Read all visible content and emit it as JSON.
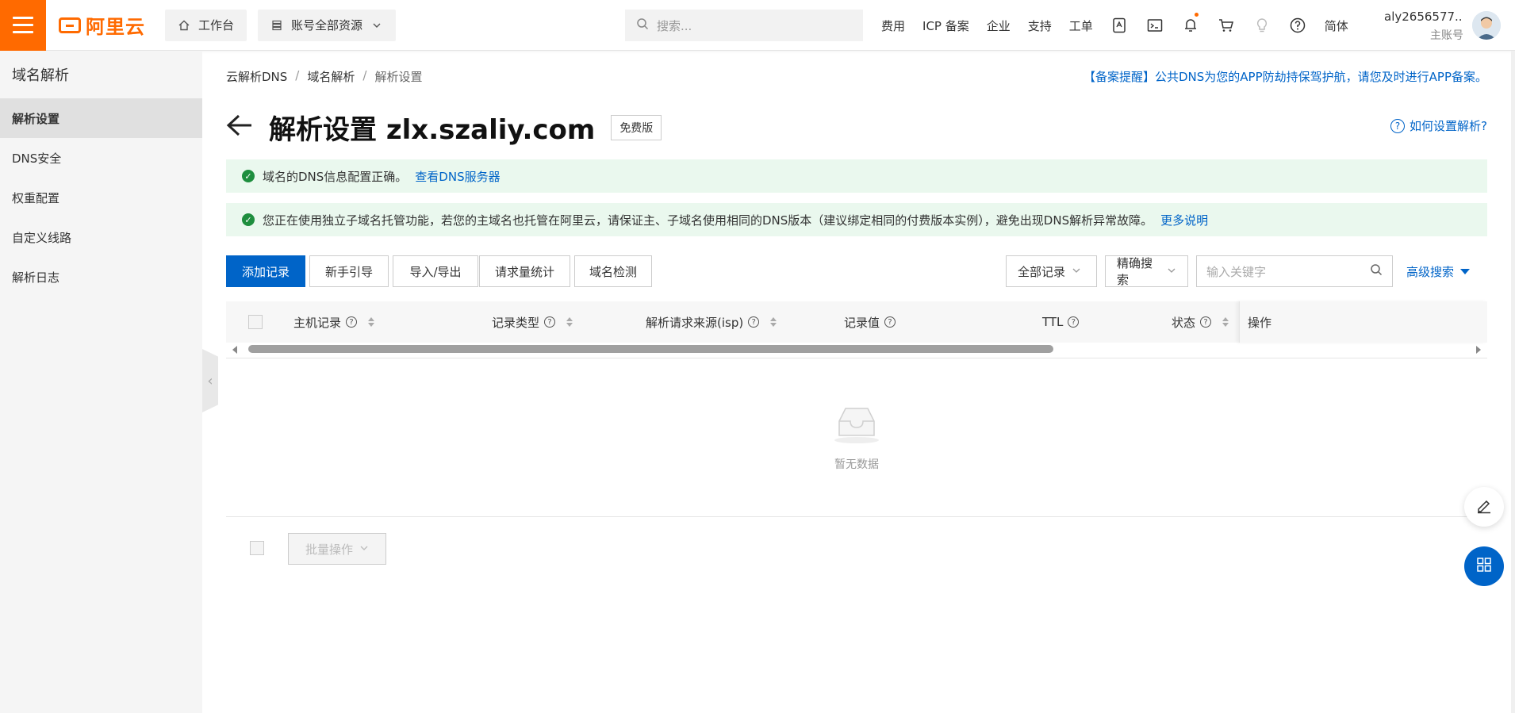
{
  "topbar": {
    "logo_text": "阿里云",
    "workbench_label": "工作台",
    "resources_label": "账号全部资源",
    "search_placeholder": "搜索...",
    "links": [
      "费用",
      "ICP 备案",
      "企业",
      "支持",
      "工单"
    ],
    "lang_label": "简体",
    "user_name": "aly2656577...",
    "user_role": "主账号"
  },
  "sidebar": {
    "title": "域名解析",
    "items": [
      {
        "label": "解析设置",
        "active": true
      },
      {
        "label": "DNS安全",
        "active": false
      },
      {
        "label": "权重配置",
        "active": false
      },
      {
        "label": "自定义线路",
        "active": false
      },
      {
        "label": "解析日志",
        "active": false
      }
    ]
  },
  "breadcrumb": [
    "云解析DNS",
    "域名解析",
    "解析设置"
  ],
  "notice": "【备案提醒】公共DNS为您的APP防劫持保驾护航，请您及时进行APP备案。",
  "page": {
    "title": "解析设置 zlx.szaliy.com",
    "edition": "免费版",
    "help": "如何设置解析?"
  },
  "alerts": [
    {
      "text": "域名的DNS信息配置正确。",
      "link": "查看DNS服务器"
    },
    {
      "text": "您正在使用独立子域名托管功能，若您的主域名也托管在阿里云，请保证主、子域名使用相同的DNS版本（建议绑定相同的付费版本实例），避免出现DNS解析异常故障。",
      "link": "更多说明"
    }
  ],
  "toolbar": {
    "add_record": "添加记录",
    "guide": "新手引导",
    "import_export": "导入/导出",
    "stats": "请求量统计",
    "check": "域名检测",
    "filter_all": "全部记录",
    "exact_search": "精确搜索",
    "keyword_placeholder": "输入关键字",
    "advanced": "高级搜索"
  },
  "table": {
    "columns": [
      "主机记录",
      "记录类型",
      "解析请求来源(isp)",
      "记录值",
      "TTL",
      "状态",
      "操作"
    ],
    "empty_text": "暂无数据",
    "batch_label": "批量操作"
  },
  "colors": {
    "brand": "#ff6a00",
    "primary": "#0064c8",
    "success": "#1e8e3e",
    "alert_bg": "#eaf8ee"
  }
}
